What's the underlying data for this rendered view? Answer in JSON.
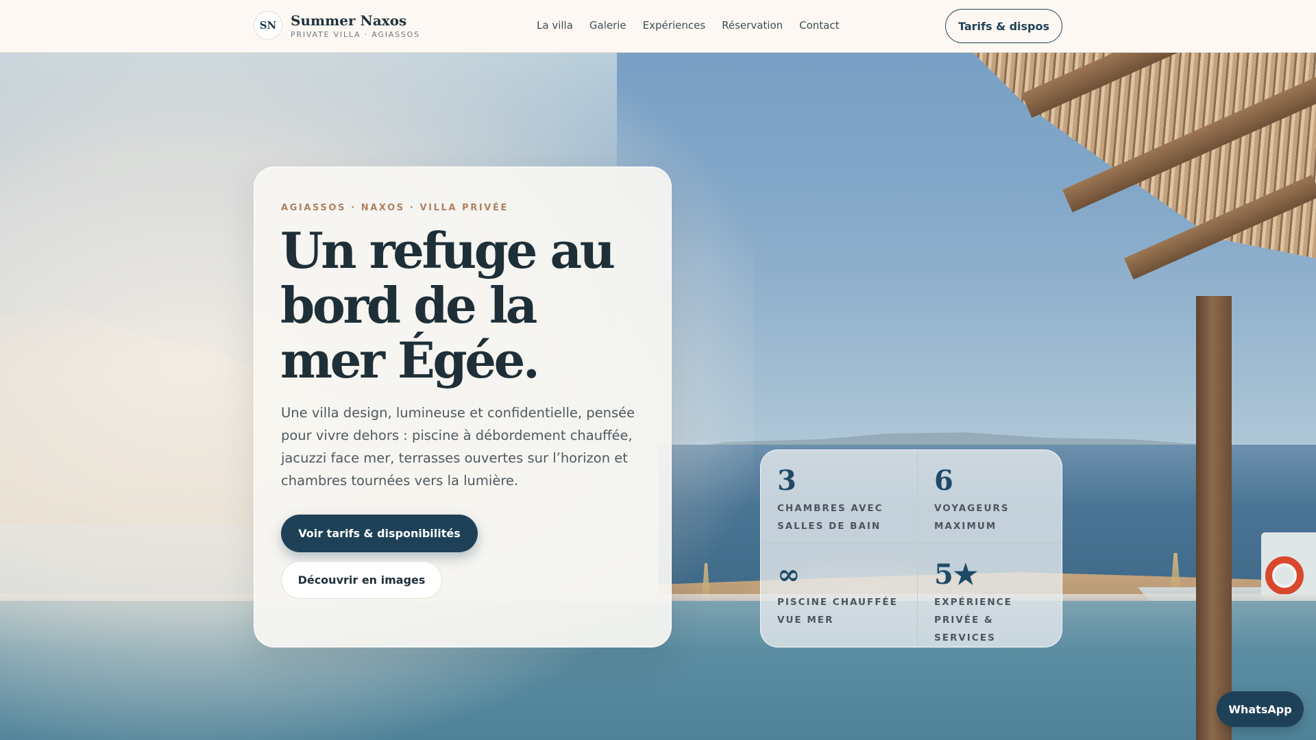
{
  "header": {
    "logo_initials": "SN",
    "brand_name": "Summer Naxos",
    "brand_sub": "PRIVATE VILLA · AGIASSOS",
    "nav": [
      {
        "label": "La villa"
      },
      {
        "label": "Galerie"
      },
      {
        "label": "Expériences"
      },
      {
        "label": "Réservation"
      },
      {
        "label": "Contact"
      }
    ],
    "cta_label": "Tarifs & dispos"
  },
  "hero": {
    "eyebrow": "AGIASSOS · NAXOS · VILLA PRIVÉE",
    "headline": "Un refuge au bord de la mer Égée.",
    "lead": "Une villa design, lumineuse et confidentielle, pensée pour vivre dehors : piscine à débordement chauffée, jacuzzi face mer, terrasses ouvertes sur l’horizon et chambres tournées vers la lumière.",
    "primary_cta": "Voir tarifs & disponibilités",
    "secondary_cta": "Découvrir en images"
  },
  "stats": [
    {
      "value": "3",
      "label": "CHAMBRES AVEC SALLES DE BAIN"
    },
    {
      "value": "6",
      "label": "VOYAGEURS MAXIMUM"
    },
    {
      "value": "∞",
      "label": "PISCINE CHAUFFÉE VUE MER"
    },
    {
      "value": "5★",
      "label": "EXPÉRIENCE PRIVÉE & SERVICES"
    }
  ],
  "floating": {
    "whatsapp_label": "WhatsApp"
  },
  "colors": {
    "primary": "#1f4158",
    "accent": "#b07f5f",
    "header_bg": "#fdf8f3",
    "heading": "#1f2f38"
  }
}
